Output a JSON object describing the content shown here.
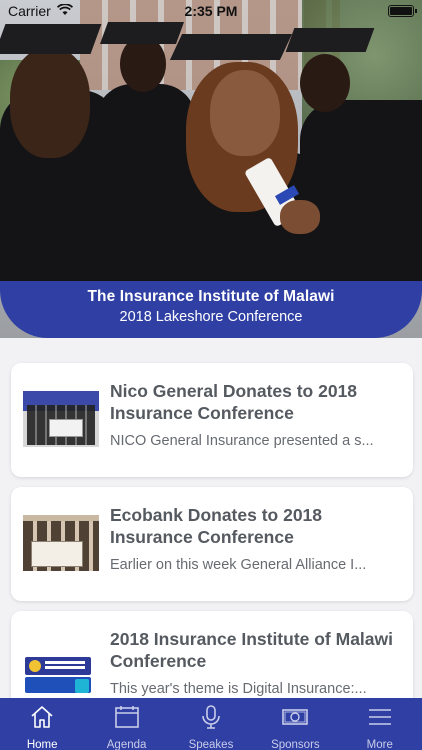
{
  "status_bar": {
    "carrier": "Carrier",
    "time": "2:35 PM",
    "battery_level": 1.0
  },
  "banner": {
    "title": "The Insurance Institute of Malawi",
    "subtitle": "2018 Lakeshore Conference",
    "color": "#2f3fa3"
  },
  "news": [
    {
      "title": "Nico General Donates to 2018 Insurance Conference",
      "excerpt": "NICO General Insurance presented a s...",
      "thumbnail": "donation-photo"
    },
    {
      "title": "Ecobank Donates to 2018 Insurance Conference",
      "excerpt": "Earlier on this week General Alliance I...",
      "thumbnail": "cheque-photo"
    },
    {
      "title": "2018 Insurance Institute of Malawi Conference",
      "excerpt": "This year's theme is Digital Insurance:...",
      "thumbnail": "conference-logo"
    }
  ],
  "tab_bar": {
    "active": "Home",
    "items": [
      {
        "label": "Home",
        "icon": "home-icon"
      },
      {
        "label": "Agenda",
        "icon": "calendar-icon"
      },
      {
        "label": "Speakes",
        "icon": "microphone-icon"
      },
      {
        "label": "Sponsors",
        "icon": "banknote-icon"
      },
      {
        "label": "More",
        "icon": "menu-icon"
      }
    ]
  }
}
